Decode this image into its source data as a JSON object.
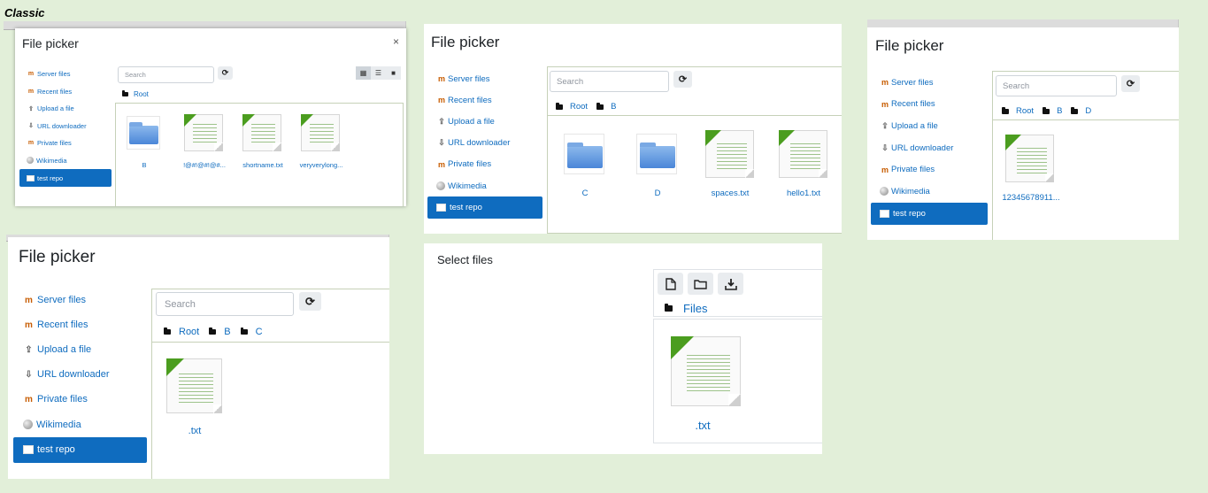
{
  "caption": "Classic",
  "panel1": {
    "title": "File picker",
    "close": "×",
    "nav": [
      "Server files",
      "Recent files",
      "Upload a file",
      "URL downloader",
      "Private files",
      "Wikimedia",
      "test repo"
    ],
    "search_placeholder": "Search",
    "crumbs": [
      "Root"
    ],
    "files": [
      ".B",
      "!@#!@#!@#...",
      "shortname.txt",
      "veryverylong..."
    ]
  },
  "panel1_filenames": [
    "B",
    "!@#!@#!@#...",
    "shortname.txt",
    "veryverylong..."
  ],
  "panel2": {
    "title": "File picker",
    "nav": [
      "Server files",
      "Recent files",
      "Upload a file",
      "URL downloader",
      "Private files",
      "Wikimedia",
      "test repo"
    ],
    "search_placeholder": "Search",
    "crumbs": [
      "Root",
      "B"
    ],
    "files": [
      "C",
      "D",
      "spaces.txt",
      "hello1.txt"
    ]
  },
  "panel3": {
    "title": "File picker",
    "nav": [
      "Server files",
      "Recent files",
      "Upload a file",
      "URL downloader",
      "Private files",
      "Wikimedia",
      "test repo"
    ],
    "search_placeholder": "Search",
    "crumbs": [
      "Root",
      "B",
      "D"
    ],
    "files": [
      "12345678911..."
    ]
  },
  "panel4": {
    "title": "File picker",
    "nav": [
      "Server files",
      "Recent files",
      "Upload a file",
      "URL downloader",
      "Private files",
      "Wikimedia",
      "test repo"
    ],
    "search_placeholder": "Search",
    "crumbs": [
      "Root",
      "B",
      "C"
    ],
    "files": [
      ".txt"
    ]
  },
  "select_files": {
    "label": "Select files",
    "crumb": "Files",
    "file": ".txt"
  },
  "colors": {
    "link": "#0f6cbf",
    "active_bg": "#0f6cbf",
    "page_bg": "#e2efd9"
  }
}
